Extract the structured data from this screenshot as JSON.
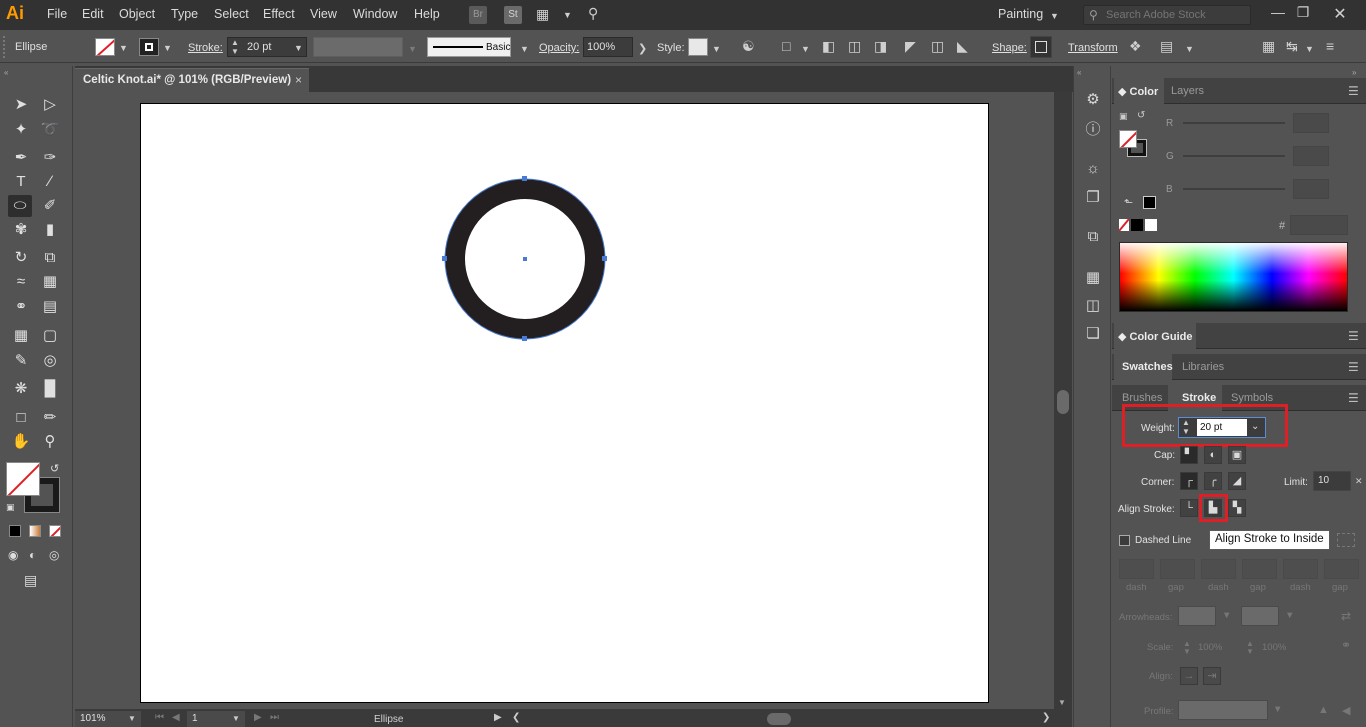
{
  "app": {
    "logo": "Ai"
  },
  "menu": [
    "File",
    "Edit",
    "Object",
    "Type",
    "Select",
    "Effect",
    "View",
    "Window",
    "Help"
  ],
  "workspace": "Painting",
  "search": {
    "placeholder": "Search Adobe Stock"
  },
  "control_bar": {
    "object_type": "Ellipse",
    "stroke_label": "Stroke:",
    "stroke_value": "20 pt",
    "brush_label": "Basic",
    "opacity_label": "Opacity:",
    "opacity_value": "100%",
    "style_label": "Style:",
    "shape_label": "Shape:",
    "transform_label": "Transform"
  },
  "document_tab": {
    "title": "Celtic Knot.ai* @ 101% (RGB/Preview)",
    "close": "×"
  },
  "status_bar": {
    "zoom": "101%",
    "artboard_number": "1",
    "selection": "Ellipse"
  },
  "color_panel": {
    "tabs": [
      "Color",
      "Layers"
    ],
    "channels": [
      "R",
      "G",
      "B"
    ],
    "hash": "#"
  },
  "color_guide": {
    "title": "Color Guide"
  },
  "swatches_tabs": [
    "Swatches",
    "Libraries"
  ],
  "stroke_panel": {
    "tabs": [
      "Brushes",
      "Stroke",
      "Symbols"
    ],
    "weight_label": "Weight:",
    "weight_value": "20 pt",
    "cap_label": "Cap:",
    "corner_label": "Corner:",
    "limit_label": "Limit:",
    "limit_value": "10",
    "align_label": "Align Stroke:",
    "dashed_label": "Dashed Line",
    "dash_labels": [
      "dash",
      "gap",
      "dash",
      "gap",
      "dash",
      "gap"
    ],
    "arrowheads_label": "Arrowheads:",
    "scale_label": "Scale:",
    "scale_value_1": "100%",
    "scale_value_2": "100%",
    "align_arrow_label": "Align:",
    "profile_label": "Profile:"
  },
  "tooltip": "Align Stroke to Inside",
  "colors": {
    "accent_red": "#e01e26",
    "circle_fill": "#231f20",
    "selection": "#4a7bd4"
  }
}
